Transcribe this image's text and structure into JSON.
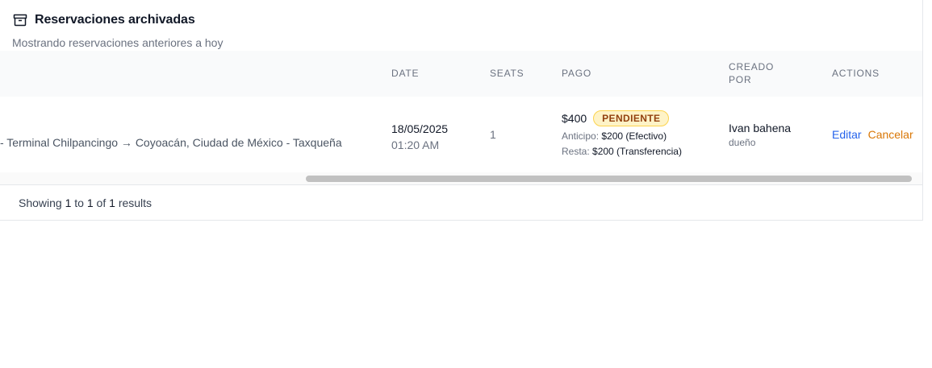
{
  "header": {
    "icon": "archive-icon",
    "title": "Reservaciones archivadas",
    "subtitle": "Mostrando reservaciones anteriores a hoy"
  },
  "table": {
    "columns": {
      "date": "DATE",
      "seats": "SEATS",
      "pago": "PAGO",
      "creado_line1": "CREADO",
      "creado_line2": "POR",
      "actions": "ACTIONS"
    },
    "rows": [
      {
        "route": "- Terminal Chilpancingo → Coyoacán, Ciudad de México - Taxqueña",
        "date": "18/05/2025",
        "time": "01:20 AM",
        "seats": "1",
        "pago": {
          "amount": "$400",
          "status": "PENDIENTE",
          "anticipo_label": "Anticipo:",
          "anticipo_value": "$200 (Efectivo)",
          "resta_label": "Resta:",
          "resta_value": "$200 (Transferencia)"
        },
        "creator": {
          "name": "Ivan bahena",
          "role": "dueño"
        },
        "actions": {
          "edit": "Editar",
          "cancel": "Cancelar"
        }
      }
    ]
  },
  "footer": {
    "showing": "Showing",
    "from": "1",
    "to_word": "to",
    "to": "1",
    "of_word": "of",
    "total": "1",
    "results": "results"
  },
  "colors": {
    "accent_link": "#2563eb",
    "cancel_link": "#d97706",
    "badge_bg": "#fef3c7",
    "badge_text": "#92400e"
  }
}
